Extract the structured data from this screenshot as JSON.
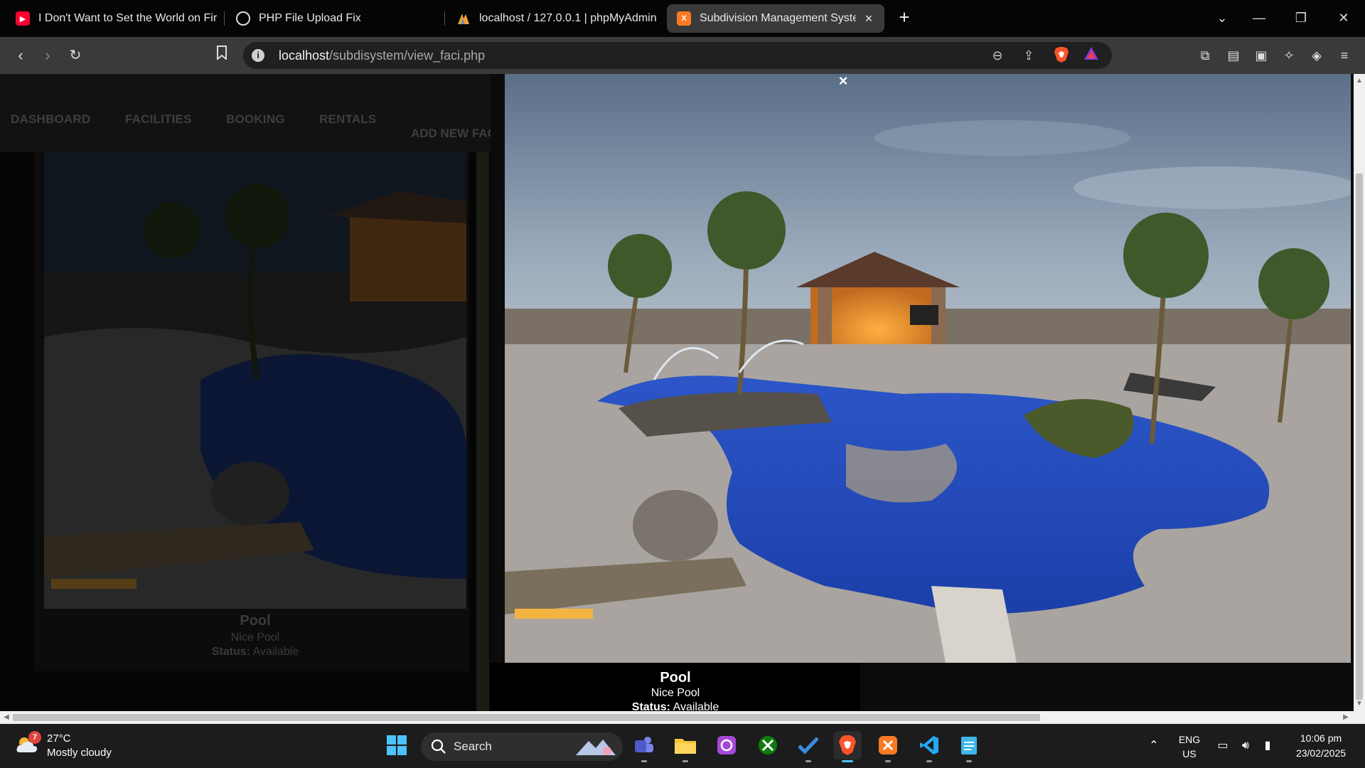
{
  "browser": {
    "tabs": [
      {
        "title": "I Don't Want to Set the World on Fir",
        "favicon": "youtube-icon",
        "active": false
      },
      {
        "title": "PHP File Upload Fix",
        "favicon": "chatgpt-icon",
        "active": false
      },
      {
        "title": "localhost / 127.0.0.1 | phpMyAdmin",
        "favicon": "phpmyadmin-icon",
        "active": false
      },
      {
        "title": "Subdivision Management Syste",
        "favicon": "xampp-icon",
        "active": true
      }
    ],
    "url_host": "localhost",
    "url_path": "/subdisystem/view_faci.php"
  },
  "page": {
    "nav": [
      "DASHBOARD",
      "FACILITIES",
      "BOOKING",
      "RENTALS"
    ],
    "add_new": "ADD NEW FAC",
    "card": {
      "name": "Pool",
      "description": "Nice Pool",
      "status_label": "Status:",
      "status_value": "Available"
    },
    "modal": {
      "close_symbol": "×",
      "name": "Pool",
      "description": "Nice Pool",
      "status_label": "Status:",
      "status_value": "Available"
    }
  },
  "taskbar": {
    "weather_badge": "7",
    "weather_temp": "27°C",
    "weather_desc": "Mostly cloudy",
    "search_label": "Search",
    "lang_line1": "ENG",
    "lang_line2": "US",
    "time": "10:06 pm",
    "date": "23/02/2025"
  },
  "colors": {
    "accent": "#4cc2ff",
    "tab_active": "#3a3a3a",
    "brave_orange": "#fb542b"
  }
}
